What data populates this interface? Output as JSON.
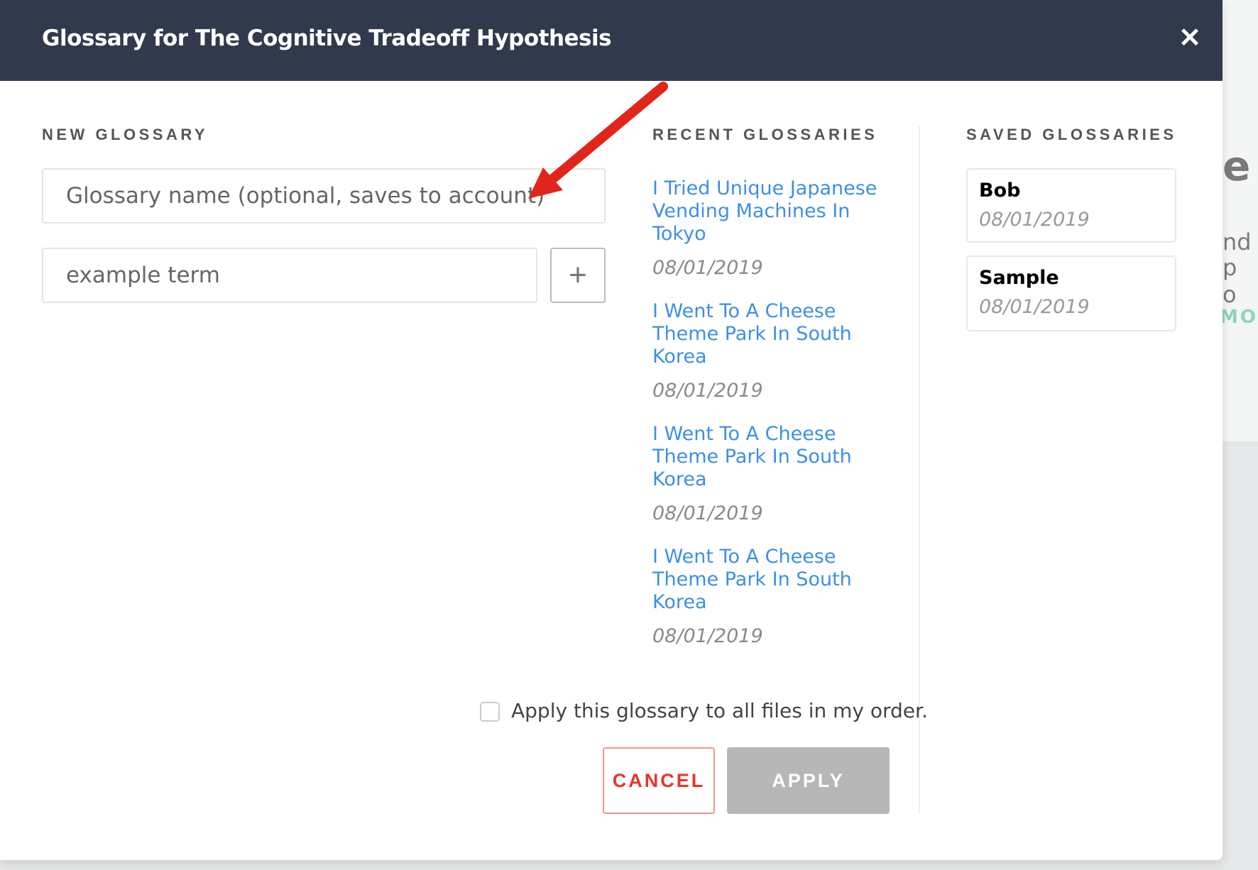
{
  "modal": {
    "title": "Glossary for The Cognitive Tradeoff Hypothesis",
    "close_icon": "close-icon"
  },
  "new_glossary": {
    "heading": "NEW GLOSSARY",
    "name_placeholder": "Glossary name (optional, saves to account)",
    "term_placeholder": "example term",
    "add_icon": "plus-icon"
  },
  "recent": {
    "heading": "RECENT GLOSSARIES",
    "items": [
      {
        "title": "I Tried Unique Japanese Vending Machines In Tokyo",
        "date": "08/01/2019"
      },
      {
        "title": "I Went To A Cheese Theme Park In South Korea",
        "date": "08/01/2019"
      },
      {
        "title": "I Went To A Cheese Theme Park In South Korea",
        "date": "08/01/2019"
      },
      {
        "title": "I Went To A Cheese Theme Park In South Korea",
        "date": "08/01/2019"
      }
    ]
  },
  "saved": {
    "heading": "SAVED GLOSSARIES",
    "items": [
      {
        "name": "Bob",
        "date": "08/01/2019"
      },
      {
        "name": "Sample",
        "date": "08/01/2019"
      }
    ]
  },
  "apply_all": {
    "label": "Apply this glossary to all files in my order.",
    "checked": false
  },
  "buttons": {
    "cancel": "CANCEL",
    "apply": "APPLY"
  },
  "background": {
    "fragment1": "e",
    "fragment2": "nd",
    "fragment3": "p o",
    "fragment4": "MOR"
  },
  "colors": {
    "header": "#303a4c",
    "link": "#3d8fe6",
    "cancel": "#e6362a",
    "apply_disabled": "#b7b7b7",
    "arrow": "#e0261a"
  }
}
